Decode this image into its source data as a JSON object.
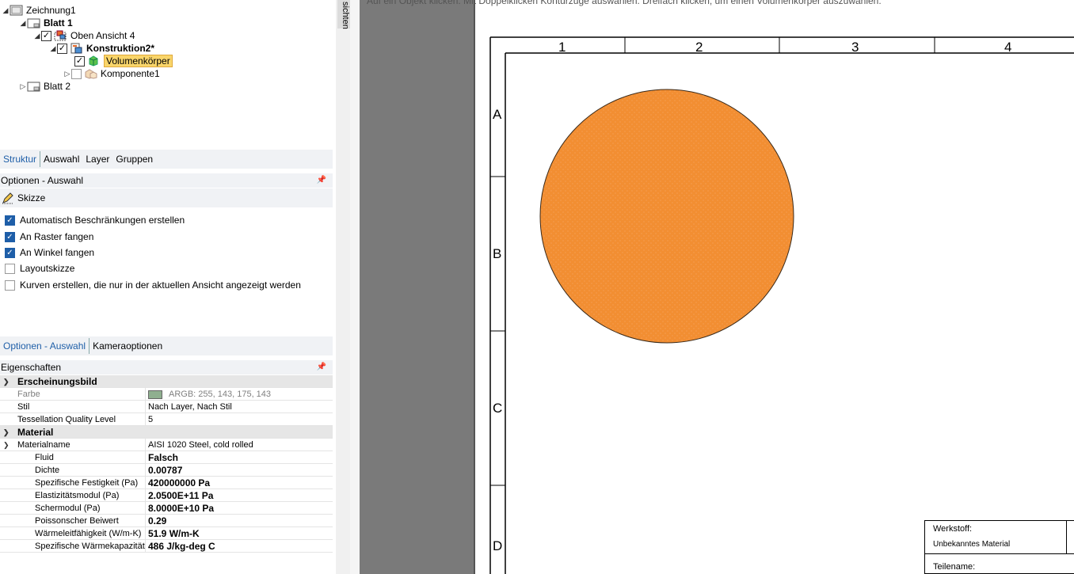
{
  "tree": {
    "root": "Zeichnung1",
    "sheet1": "Blatt 1",
    "view": "Oben Ansicht 4",
    "design": "Konstruktion2*",
    "body": "Volumenkörper",
    "component": "Komponente1",
    "sheet2": "Blatt 2"
  },
  "tabs1": [
    "Struktur",
    "Auswahl",
    "Layer",
    "Gruppen"
  ],
  "options_panel": {
    "title": "Optionen - Auswahl",
    "section": "Skizze",
    "items": [
      {
        "label": "Automatisch Beschränkungen erstellen",
        "checked": true
      },
      {
        "label": "An Raster fangen",
        "checked": true
      },
      {
        "label": "An Winkel fangen",
        "checked": true
      },
      {
        "label": "Layoutskizze",
        "checked": false
      },
      {
        "label": "Kurven erstellen, die nur in der aktuellen Ansicht angezeigt werden",
        "checked": false
      }
    ]
  },
  "tabs2": [
    "Optionen - Auswahl",
    "Kameraoptionen"
  ],
  "properties": {
    "title": "Eigenschaften",
    "cat1": "Erscheinungsbild",
    "farbe_k": "Farbe",
    "farbe_v": "ARGB: 255, 143, 175, 143",
    "stil_k": "Stil",
    "stil_v": "Nach Layer, Nach Stil",
    "tess_k": "Tessellation Quality Level",
    "tess_v": "5",
    "cat2": "Material",
    "mat_k": "Materialname",
    "mat_v": "AISI 1020 Steel, cold rolled",
    "rows": [
      {
        "k": "Fluid",
        "v": "Falsch"
      },
      {
        "k": "Dichte",
        "v": "0.00787"
      },
      {
        "k": "Spezifische Festigkeit (Pa)",
        "v": "420000000 Pa"
      },
      {
        "k": "Elastizitätsmodul (Pa)",
        "v": "2.0500E+11 Pa"
      },
      {
        "k": "Schermodul (Pa)",
        "v": "8.0000E+10 Pa"
      },
      {
        "k": "Poissonscher Beiwert",
        "v": "0.29"
      },
      {
        "k": "Wärmeleitfähigkeit (W/m-K)",
        "v": "51.9 W/m-K"
      },
      {
        "k": "Spezifische Wärmekapazität (",
        "v": "486 J/kg-deg C"
      }
    ]
  },
  "side_tab": "sichten",
  "status_message": "Auf ein Objekt klicken. Mit Doppelklicken Konturzüge auswählen. Dreifach klicken, um einen Volumenkörper auszuwählen.",
  "drawing": {
    "zone_numbers": [
      "1",
      "2",
      "3",
      "4"
    ],
    "zone_letters": [
      "A",
      "B",
      "C",
      "D"
    ],
    "title_block": {
      "werkstoff_label": "Werkstoff:",
      "werkstoff_value": "Unbekanntes Material",
      "teilename_label": "Teilename:"
    },
    "circle_color": "#f28e32"
  }
}
